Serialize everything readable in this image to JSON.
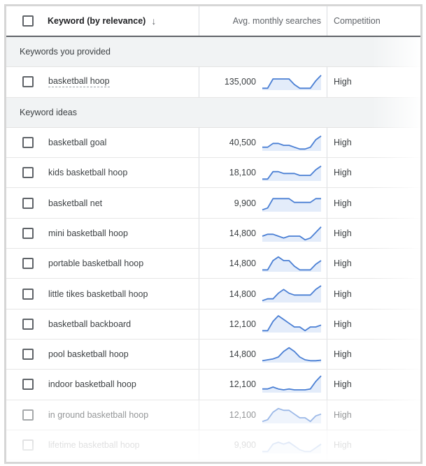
{
  "header": {
    "keyword_label": "Keyword (by relevance)",
    "sort_icon": "arrow-down-icon",
    "searches_label": "Avg. monthly searches",
    "competition_label": "Competition"
  },
  "groups": {
    "provided_label": "Keywords you provided",
    "ideas_label": "Keyword ideas"
  },
  "colors": {
    "sparkline_stroke": "#4a7fd4",
    "sparkline_fill": "#e3ecfa",
    "group_bg": "#f1f3f4"
  },
  "provided": [
    {
      "keyword": "basketball hoop",
      "searches": "135,000",
      "competition": "High",
      "trend": [
        1,
        1,
        6,
        6,
        6,
        6,
        3,
        1,
        1,
        1,
        5,
        8
      ]
    }
  ],
  "ideas": [
    {
      "keyword": "basketball goal",
      "searches": "40,500",
      "competition": "High",
      "trend": [
        2,
        2,
        4,
        4,
        3,
        3,
        2,
        1,
        1,
        2,
        6,
        8
      ]
    },
    {
      "keyword": "kids basketball hoop",
      "searches": "18,100",
      "competition": "High",
      "trend": [
        1,
        1,
        5,
        5,
        4,
        4,
        4,
        3,
        3,
        3,
        6,
        8
      ]
    },
    {
      "keyword": "basketball net",
      "searches": "9,900",
      "competition": "High",
      "trend": [
        1,
        2,
        7,
        7,
        7,
        7,
        5,
        5,
        5,
        5,
        7,
        7
      ]
    },
    {
      "keyword": "mini basketball hoop",
      "searches": "14,800",
      "competition": "High",
      "trend": [
        3,
        4,
        4,
        3,
        2,
        3,
        3,
        3,
        1,
        2,
        5,
        8
      ]
    },
    {
      "keyword": "portable basketball hoop",
      "searches": "14,800",
      "competition": "High",
      "trend": [
        1,
        1,
        6,
        8,
        6,
        6,
        3,
        1,
        1,
        1,
        4,
        6
      ]
    },
    {
      "keyword": "little tikes basketball hoop",
      "searches": "14,800",
      "competition": "High",
      "trend": [
        1,
        2,
        2,
        5,
        7,
        5,
        4,
        4,
        4,
        4,
        7,
        9
      ]
    },
    {
      "keyword": "basketball backboard",
      "searches": "12,100",
      "competition": "High",
      "trend": [
        1,
        1,
        6,
        9,
        7,
        5,
        3,
        3,
        1,
        3,
        3,
        4
      ]
    },
    {
      "keyword": "pool basketball hoop",
      "searches": "14,800",
      "competition": "High",
      "trend": [
        1,
        1.5,
        2,
        3,
        6,
        8,
        6,
        3,
        1.5,
        1,
        1,
        1.3
      ]
    },
    {
      "keyword": "indoor basketball hoop",
      "searches": "12,100",
      "competition": "High",
      "trend": [
        2,
        2,
        3,
        2,
        1.5,
        2,
        1.5,
        1.5,
        1.5,
        2,
        6,
        9
      ]
    },
    {
      "keyword": "in ground basketball hoop",
      "searches": "12,100",
      "competition": "High",
      "trend": [
        1,
        2,
        6,
        8,
        7,
        7,
        5,
        3,
        3,
        1,
        4,
        5
      ]
    },
    {
      "keyword": "lifetime basketball hoop",
      "searches": "9,900",
      "competition": "High",
      "trend": [
        1,
        1,
        5,
        6,
        5,
        6,
        4,
        2,
        1,
        1,
        3,
        5
      ]
    }
  ]
}
